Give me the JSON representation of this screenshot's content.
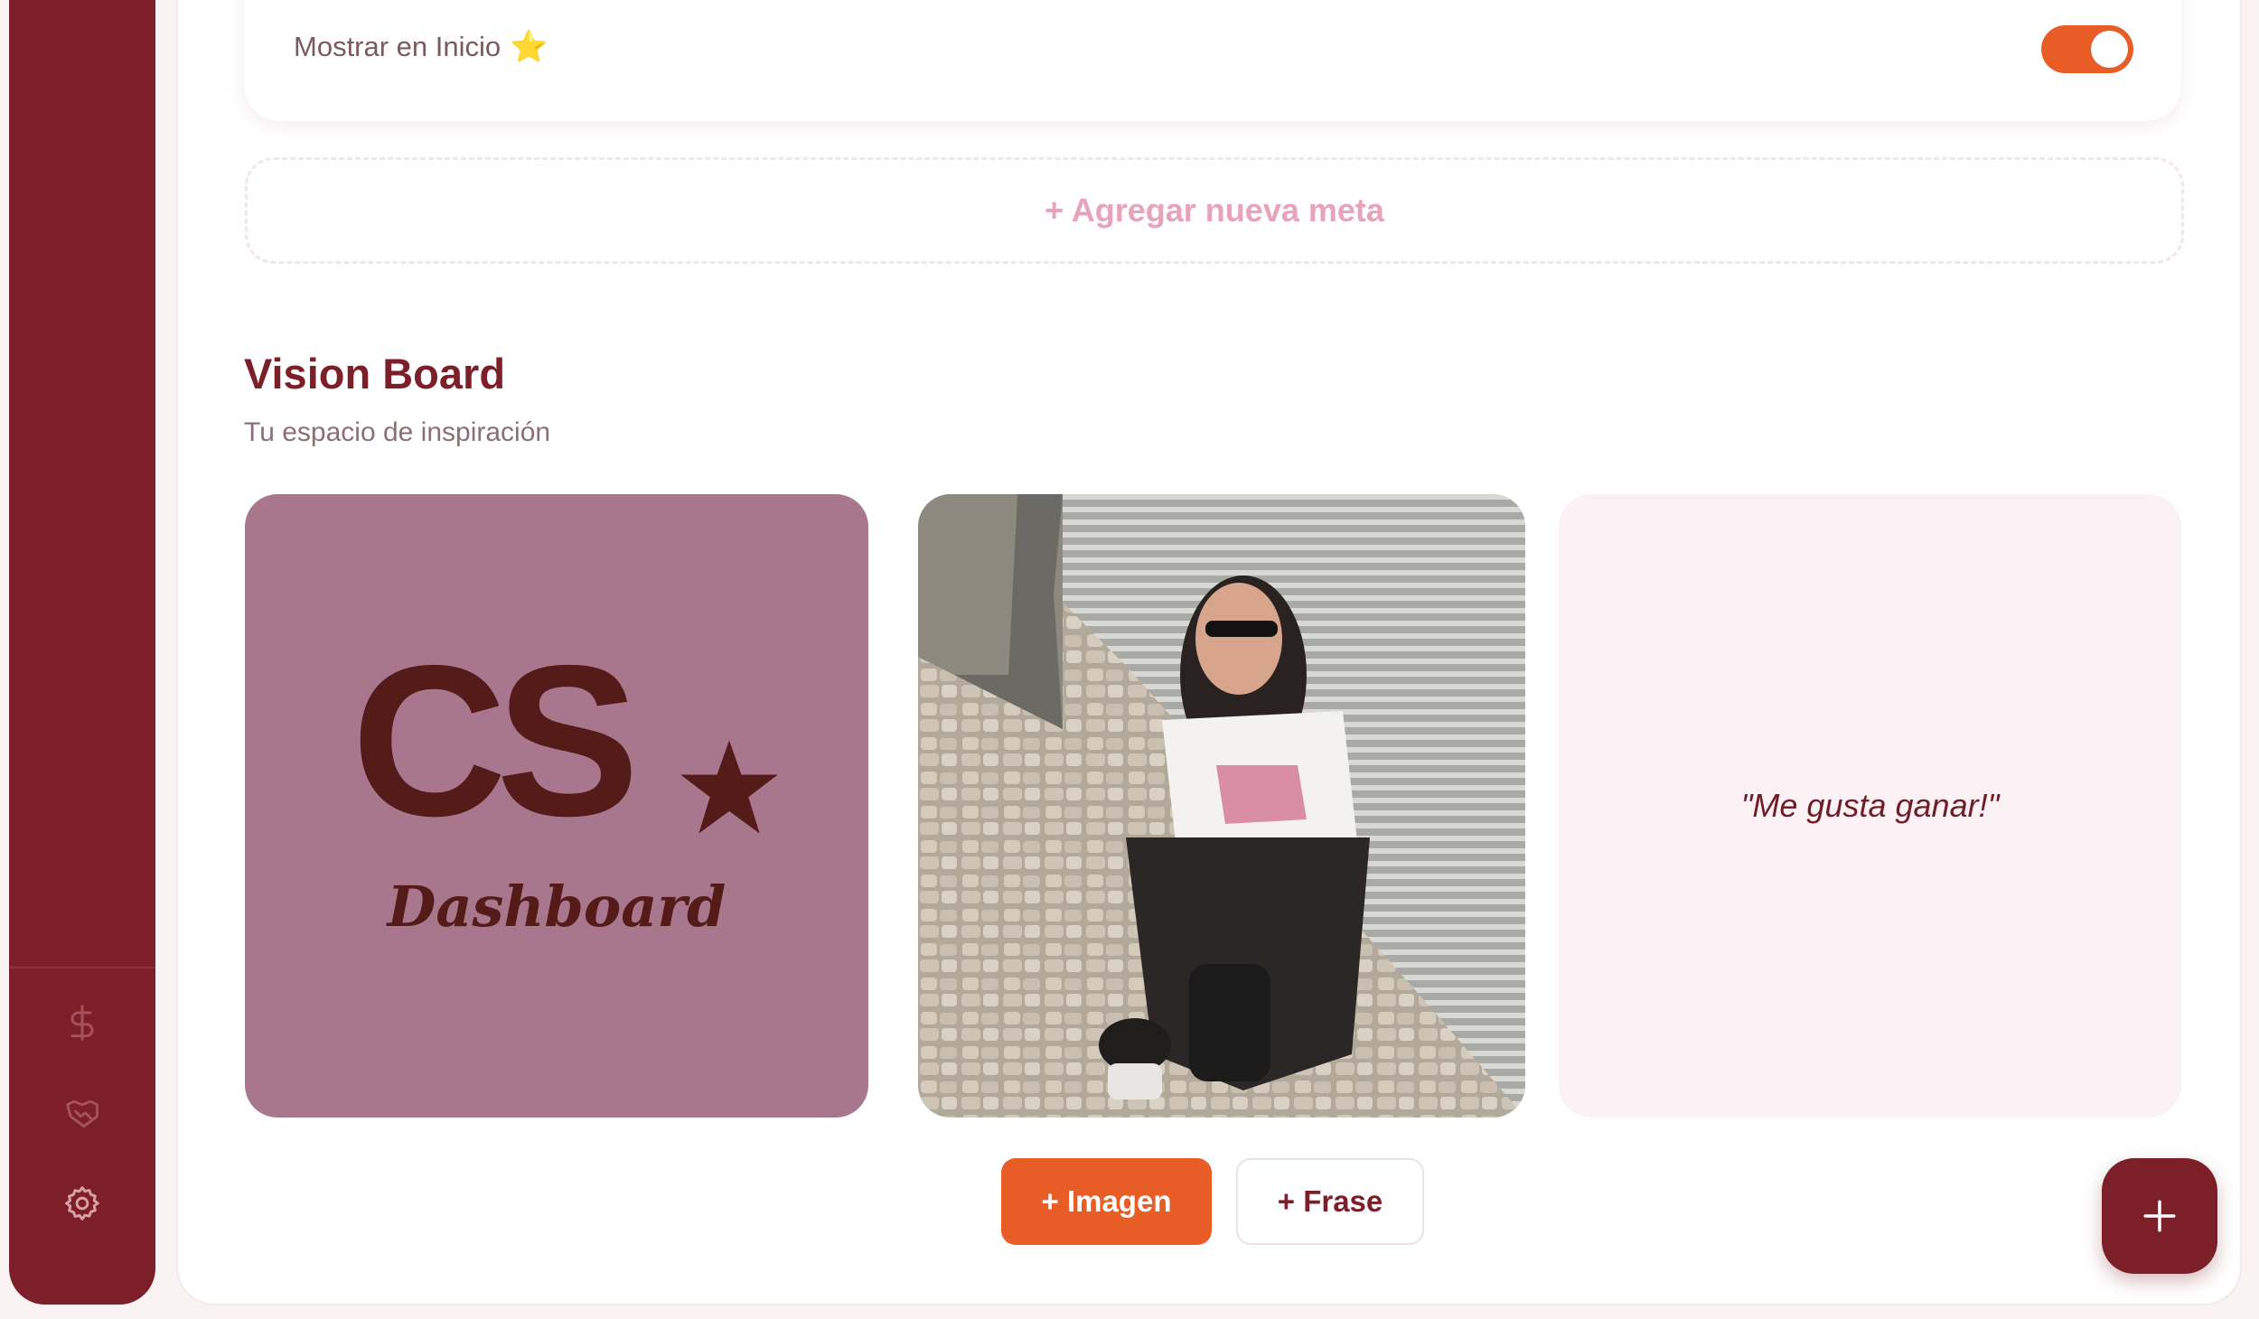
{
  "goals": {
    "show_home_label": "Mostrar en Inicio",
    "show_home_icon": "star-emoji",
    "show_home_enabled": true,
    "add_goal_label": "+ Agregar nueva meta"
  },
  "vision_board": {
    "title": "Vision Board",
    "subtitle": "Tu espacio de inspiración",
    "tiles": [
      {
        "type": "image",
        "logo_text": "CS",
        "logo_subtext": "Dashboard"
      },
      {
        "type": "image",
        "description_icon": "photo"
      },
      {
        "type": "phrase",
        "text": "\"Me gusta ganar!\""
      }
    ],
    "add_image_label": "+ Imagen",
    "add_phrase_label": "+ Frase"
  },
  "sidebar": {
    "icons": [
      "dollar-icon",
      "handshake-icon",
      "gear-icon"
    ]
  },
  "fab": {
    "icon": "plus-icon"
  },
  "colors": {
    "brand": "#7c1f28",
    "accent": "#e85d26",
    "pink": "#e6a3b9",
    "logo_bg": "#a8778e",
    "quote_bg": "#fcf1f4"
  }
}
